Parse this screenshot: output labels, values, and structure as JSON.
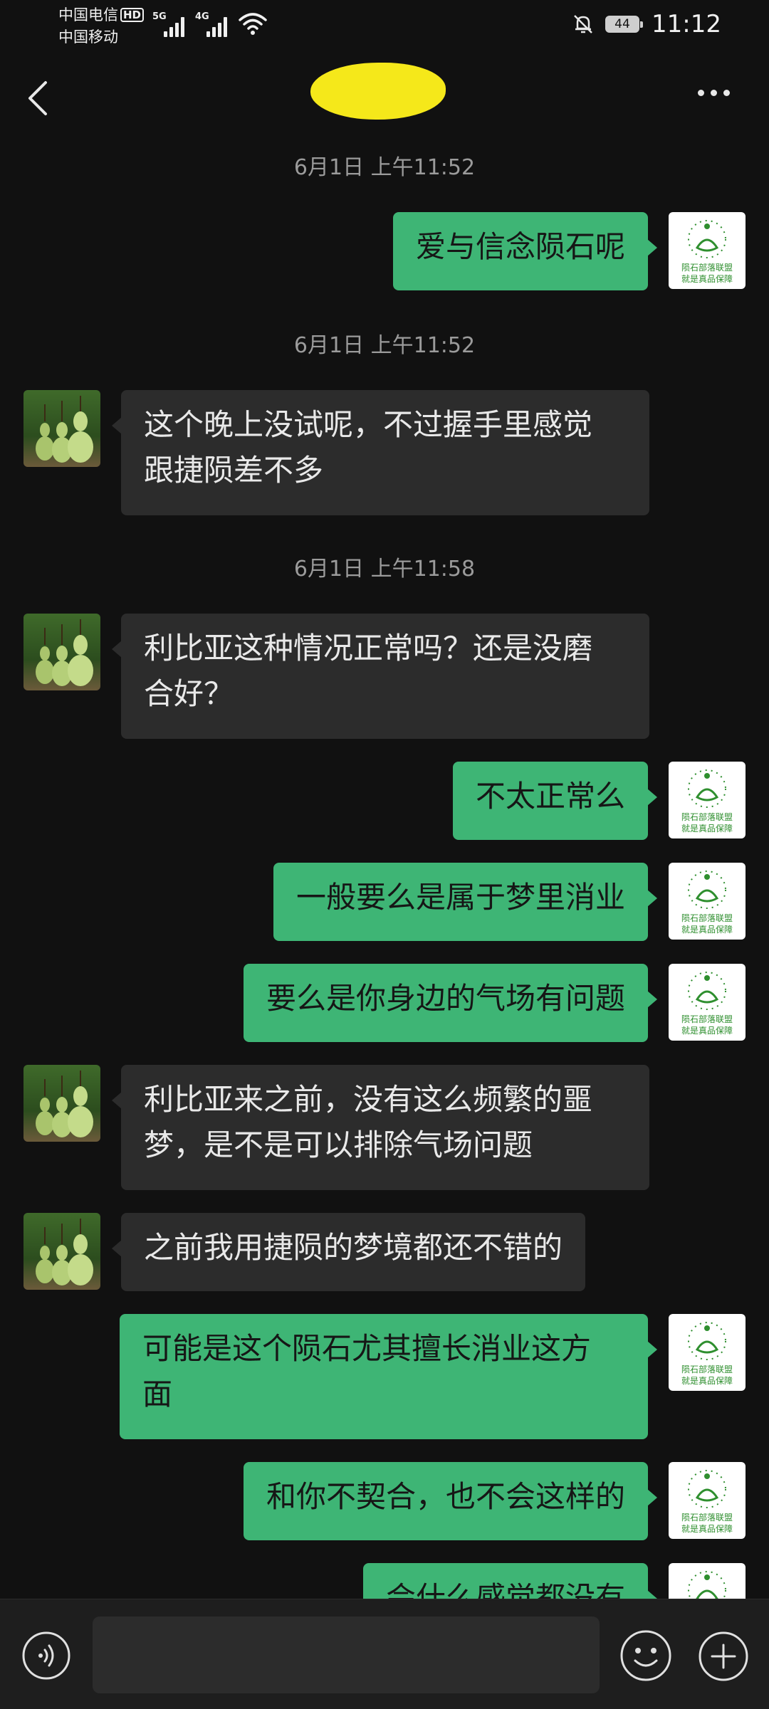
{
  "status_bar": {
    "carrier1": "中国电信",
    "carrier1_badge": "HD",
    "carrier2": "中国移动",
    "net1": "5G",
    "net2": "4G",
    "battery": "44",
    "time": "11:12"
  },
  "header": {
    "title_redacted": true
  },
  "messages": [
    {
      "type": "timestamp",
      "text": "6月1日 上午11:52"
    },
    {
      "type": "out",
      "text": "爱与信念陨石呢"
    },
    {
      "type": "timestamp",
      "text": "6月1日 上午11:52"
    },
    {
      "type": "in",
      "lines": [
        "这个晚上没试呢，不过握手里感觉",
        "跟捷陨差不多"
      ]
    },
    {
      "type": "timestamp",
      "text": "6月1日 上午11:58"
    },
    {
      "type": "in",
      "lines": [
        "利比亚这种情况正常吗？还是没磨",
        "合好？"
      ]
    },
    {
      "type": "out",
      "text": "不太正常么"
    },
    {
      "type": "out",
      "text": "一般要么是属于梦里消业"
    },
    {
      "type": "out",
      "text": "要么是你身边的气场有问题"
    },
    {
      "type": "in",
      "lines": [
        "利比亚来之前，没有这么频繁的噩",
        "梦，是不是可以排除气场问题"
      ]
    },
    {
      "type": "in",
      "text": "之前我用捷陨的梦境都还不错的"
    },
    {
      "type": "out",
      "lines": [
        "可能是这个陨石尤其擅长消业这方",
        "面"
      ]
    },
    {
      "type": "out",
      "text": "和你不契合，也不会这样的"
    },
    {
      "type": "out",
      "text": "会什么感觉都没有"
    }
  ],
  "logo_text": [
    "陨石部落联盟",
    "就是真品保障"
  ],
  "colors": {
    "background": "#111111",
    "outgoing_bubble": "#3eb575",
    "incoming_bubble": "#2c2c2c",
    "timestamp_text": "#9b9b9b"
  }
}
